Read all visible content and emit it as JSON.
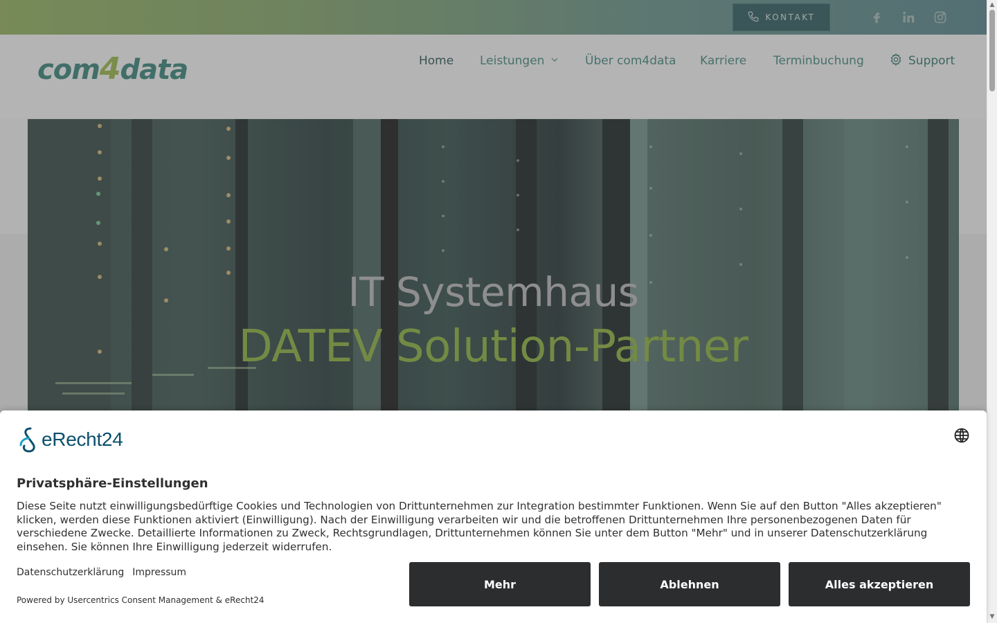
{
  "topbar": {
    "kontakt_label": "KONTAKT",
    "social": [
      {
        "icon": "facebook-icon"
      },
      {
        "icon": "linkedin-icon"
      },
      {
        "icon": "instagram-icon"
      }
    ]
  },
  "header": {
    "logo": {
      "part1": "com",
      "part2": "4",
      "part3": "data"
    },
    "nav": [
      {
        "label": "Home",
        "active": true
      },
      {
        "label": "Leistungen",
        "has_dropdown": true
      },
      {
        "label": "Über com4data"
      },
      {
        "label": "Karriere"
      },
      {
        "label": "Terminbuchung"
      },
      {
        "label": "Support",
        "icon": "gear-icon"
      }
    ]
  },
  "hero": {
    "line1": "IT Systemhaus",
    "line2": "DATEV Solution-Partner"
  },
  "consent": {
    "brand": "eRecht24",
    "title": "Privatsphäre-Einstellungen",
    "text": "Diese Seite nutzt einwilligungsbedürftige Cookies und Technologien von Drittunternehmen zur Integration bestimmter Funktionen. Wenn Sie auf den Button \"Alles akzeptieren\" klicken, werden diese Funktionen aktiviert (Einwilligung). Nach der Einwilligung verarbeiten wir und die betroffenen Drittunternehmen Ihre personenbezogenen Daten für verschiedene Zwecke. Detaillierte Informationen zu Zweck, Rechtsgrundlagen, Drittunternehmen können Sie unter dem Button \"Mehr\" und in unserer Datenschutzerklärung einsehen. Sie können Ihre Einwilligung jederzeit widerrufen.",
    "link_privacy": "Datenschutzerklärung",
    "link_imprint": "Impressum",
    "powered": "Powered by Usercentrics Consent Management & eRecht24",
    "btn_more": "Mehr",
    "btn_decline": "Ablehnen",
    "btn_accept": "Alles akzeptieren"
  },
  "colors": {
    "brand_teal": "#2f7d73",
    "brand_green": "#93b13e",
    "button_dark": "#2b2d2f"
  }
}
